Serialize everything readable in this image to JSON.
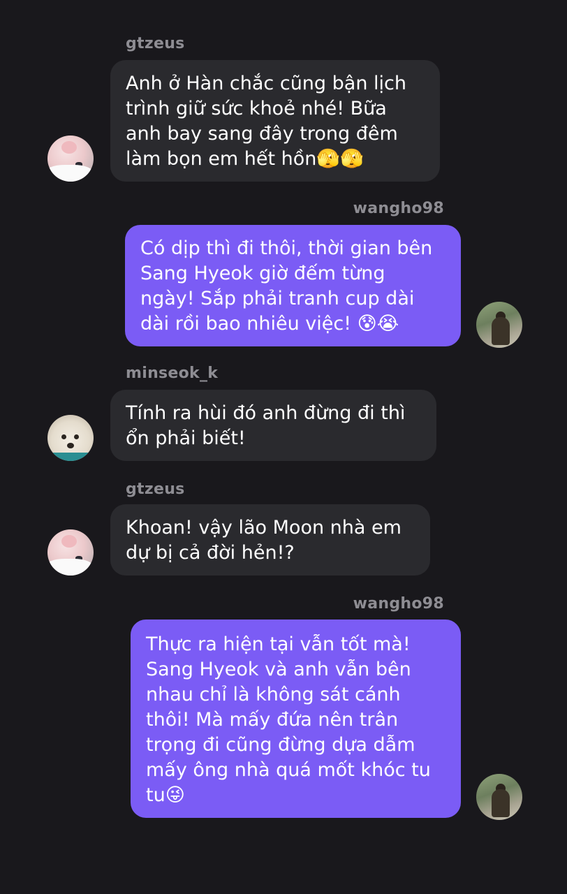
{
  "messages": [
    {
      "sender": "gtzeus",
      "text": "Anh ở Hàn chắc cũng bận lịch\ntrình giữ sức khoẻ nhé! Bữa\nanh bay sang đây trong đêm\nlàm bọn em hết hồn🫣🫣"
    },
    {
      "sender": "wangho98",
      "text": "Có dịp thì đi thôi, thời gian bên\nSang Hyeok giờ đếm từng\nngày! Sắp phải tranh cup dài\ndài rồi bao nhiêu việc! 😰😭"
    },
    {
      "sender": "minseok_k",
      "text": "Tính ra hùi đó anh đừng đi thì\nổn phải biết!"
    },
    {
      "sender": "gtzeus",
      "text": "Khoan! vậy lão Moon nhà em\ndự bị cả đời hẻn!?"
    },
    {
      "sender": "wangho98",
      "text": "Thực ra hiện tại vẫn tốt mà!\nSang Hyeok và anh vẫn bên\nnhau chỉ là không sát cánh\nthôi! Mà mấy đứa nên trân\ntrọng đi cũng đừng dựa dẫm\nmấy ông nhà quá mốt khóc tu\ntu😜"
    }
  ],
  "colors": {
    "background": "#19181c",
    "incoming_bubble": "#2a2a2e",
    "outgoing_bubble": "#7b5cf5",
    "username": "#8e8d93"
  }
}
